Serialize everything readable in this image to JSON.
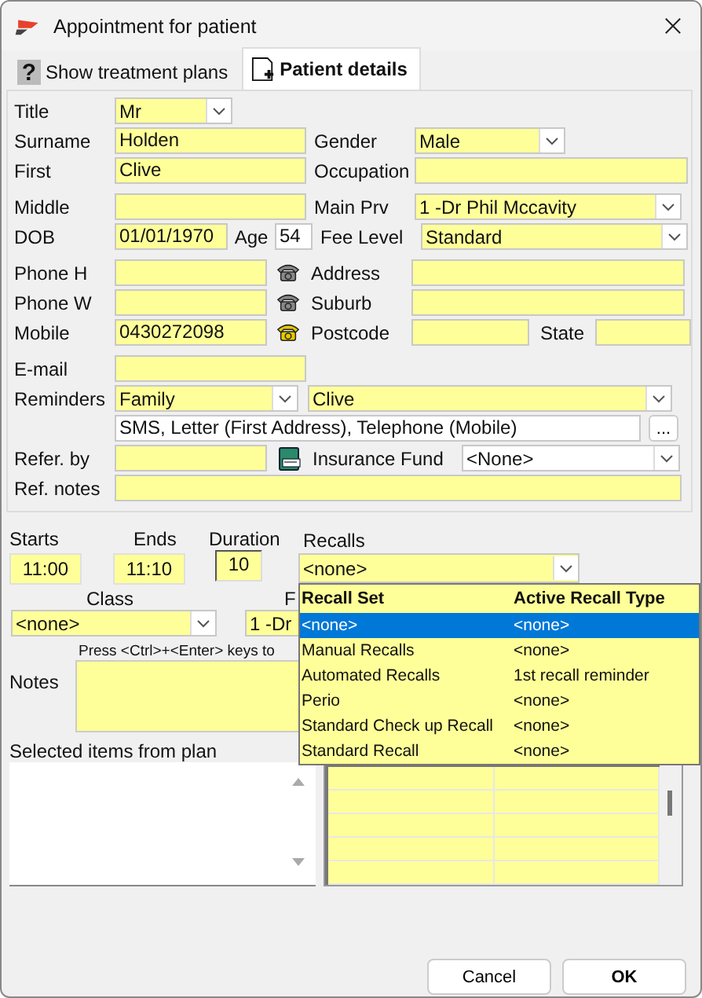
{
  "window": {
    "title": "Appointment for patient"
  },
  "tabs": [
    {
      "label": "Show treatment plans",
      "icon": "?",
      "kind": "help",
      "selected": false
    },
    {
      "label": "Patient details",
      "kind": "document",
      "selected": true
    }
  ],
  "patient": {
    "title": {
      "label": "Title",
      "value": "Mr"
    },
    "surname": {
      "label": "Surname",
      "value": "Holden"
    },
    "gender": {
      "label": "Gender",
      "value": "Male"
    },
    "first": {
      "label": "First",
      "value": "Clive"
    },
    "occupation": {
      "label": "Occupation"
    },
    "middle": {
      "label": "Middle"
    },
    "main_prv": {
      "label": "Main Prv",
      "value": "1 -Dr Phil Mccavity"
    },
    "dob": {
      "label": "DOB",
      "value": "01/01/1970"
    },
    "age": {
      "label": "Age",
      "value": "54"
    },
    "fee_level": {
      "label": "Fee Level",
      "value": "Standard"
    },
    "phone_h": {
      "label": "Phone H",
      "phone_active": false
    },
    "address": {
      "label": "Address"
    },
    "phone_w": {
      "label": "Phone W",
      "phone_active": false
    },
    "suburb": {
      "label": "Suburb"
    },
    "mobile": {
      "label": "Mobile",
      "value": "0430272098",
      "phone_active": true
    },
    "postcode": {
      "label": "Postcode"
    },
    "state": {
      "label": "State"
    },
    "email": {
      "label": "E-mail"
    },
    "reminders": {
      "label": "Reminders",
      "group": "Family",
      "person": "Clive",
      "methods": "SMS, Letter (First Address), Telephone (Mobile)",
      "more_button": "..."
    },
    "refer_by": {
      "label": "Refer. by"
    },
    "insurance_fund": {
      "label": "Insurance Fund",
      "value": "<None>"
    },
    "ref_notes": {
      "label": "Ref. notes"
    }
  },
  "appointment": {
    "starts": {
      "label": "Starts",
      "value": "11:00"
    },
    "ends": {
      "label": "Ends",
      "value": "11:10"
    },
    "duration": {
      "label": "Duration",
      "value": "10"
    },
    "recalls": {
      "label": "Recalls",
      "value": "<none>"
    },
    "class": {
      "label": "Class",
      "value": "<none>"
    },
    "provider": {
      "label": "F",
      "value": "1 -Dr"
    },
    "notes_hint": "Press <Ctrl>+<Enter> keys to",
    "notes": {
      "label": "Notes"
    },
    "selected_items": {
      "label": "Selected items from plan"
    }
  },
  "recall_dropdown": {
    "columns": [
      "Recall Set",
      "Active Recall Type"
    ],
    "rows": [
      {
        "recall_set": "<none>",
        "active_type": "<none>",
        "selected": true
      },
      {
        "recall_set": "Manual Recalls",
        "active_type": "<none>",
        "selected": false
      },
      {
        "recall_set": "Automated Recalls",
        "active_type": "1st recall reminder",
        "selected": false
      },
      {
        "recall_set": "Perio",
        "active_type": "<none>",
        "selected": false
      },
      {
        "recall_set": "Standard Check up Recall",
        "active_type": "<none>",
        "selected": false
      },
      {
        "recall_set": "Standard Recall",
        "active_type": "<none>",
        "selected": false
      }
    ]
  },
  "buttons": [
    {
      "label": "Cancel",
      "default": false
    },
    {
      "label": "OK",
      "default": true
    }
  ]
}
